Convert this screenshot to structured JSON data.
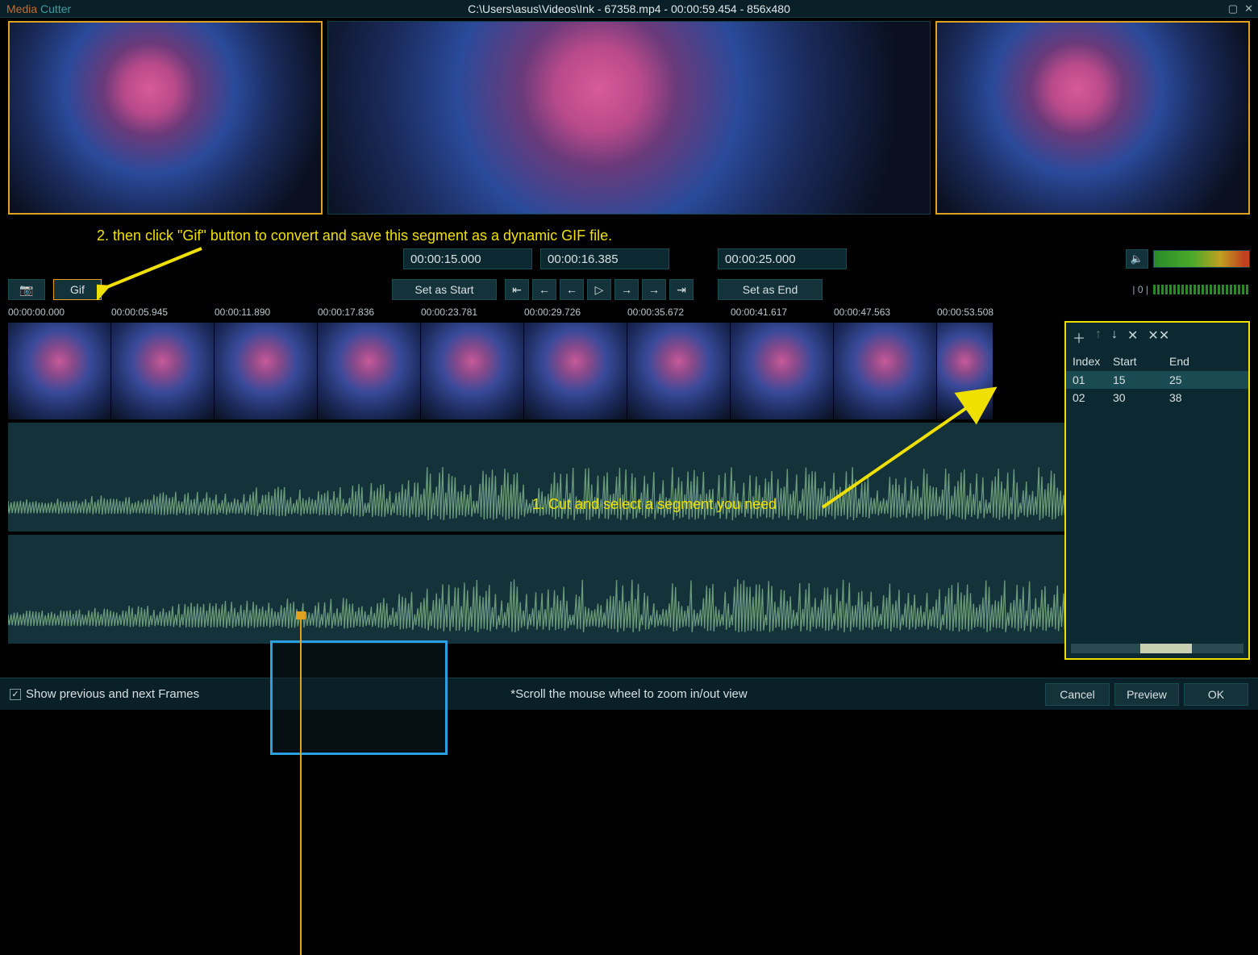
{
  "titlebar": {
    "app_media": "Media",
    "app_cutter": " Cutter",
    "path": "C:\\Users\\asus\\Videos\\Ink - 67358.mp4 - 00:00:59.454 - 856x480"
  },
  "annotations": {
    "step2": "2. then click \"Gif\" button to convert and save this segment as a dynamic GIF file.",
    "step1": "1. Cut and select a segment you need"
  },
  "times": {
    "start": "00:00:15.000",
    "current": "00:00:16.385",
    "end": "00:00:25.000"
  },
  "buttons": {
    "gif": "Gif",
    "set_start": "Set as Start",
    "set_end": "Set as End"
  },
  "level_label": "| 0 |",
  "ruler": [
    "00:00:00.000",
    "00:00:05.945",
    "00:00:11.890",
    "00:00:17.836",
    "00:00:23.781",
    "00:00:29.726",
    "00:00:35.672",
    "00:00:41.617",
    "00:00:47.563",
    "00:00:53.508"
  ],
  "segment_panel": {
    "headers": {
      "index": "Index",
      "start": "Start",
      "end": "End"
    },
    "rows": [
      {
        "index": "01",
        "start": "15",
        "end": "25",
        "selected": true
      },
      {
        "index": "02",
        "start": "30",
        "end": "38",
        "selected": false
      }
    ]
  },
  "footer": {
    "checkbox": "Show previous and next Frames",
    "hint": "*Scroll the mouse wheel to zoom in/out view",
    "cancel": "Cancel",
    "preview": "Preview",
    "ok": "OK"
  }
}
